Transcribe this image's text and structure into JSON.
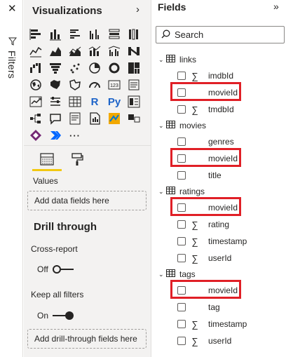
{
  "filters": {
    "label": "Filters",
    "close_icon": "close-icon",
    "funnel_icon": "funnel-icon"
  },
  "visualizations": {
    "title": "Visualizations",
    "collapse_icon": "chevron-right-icon",
    "icons": [
      "stacked-bar-chart",
      "stacked-column-chart",
      "clustered-bar-chart",
      "clustered-column-chart",
      "100-stacked-bar-chart",
      "100-stacked-column-chart",
      "line-chart",
      "area-chart",
      "stacked-area-chart",
      "line-and-stacked-column-chart",
      "line-and-clustered-column-chart",
      "ribbon-chart",
      "waterfall-chart",
      "funnel-chart",
      "scatter-chart",
      "pie-chart",
      "donut-chart",
      "treemap",
      "map",
      "filled-map",
      "shape-map",
      "gauge",
      "card",
      "multi-row-card",
      "kpi",
      "slicer",
      "table",
      "r-script-visual",
      "python-visual",
      "key-influencers",
      "decomposition-tree",
      "qna-visual",
      "smart-narrative",
      "paginated-report",
      "arcgis-map",
      "get-more-visuals",
      "power-apps",
      "power-automate",
      "more"
    ],
    "icon_text": {
      "r": "R",
      "py": "Py",
      "more": "···",
      "kpi": "123"
    },
    "values_label": "Values",
    "values_placeholder": "Add data fields here",
    "drill_through_title": "Drill through",
    "cross_report_label": "Cross-report",
    "cross_report_state": "Off",
    "keep_all_filters_label": "Keep all filters",
    "keep_all_filters_state": "On",
    "drill_placeholder": "Add drill-through fields here"
  },
  "fields": {
    "title": "Fields",
    "collapse_icon": "double-chevron-right-icon",
    "search_placeholder": "Search",
    "tables": [
      {
        "name": "links",
        "fields": [
          {
            "name": "imdbId",
            "sigma": true
          },
          {
            "name": "movieId",
            "sigma": false,
            "highlighted": true
          },
          {
            "name": "tmdbId",
            "sigma": true
          }
        ]
      },
      {
        "name": "movies",
        "fields": [
          {
            "name": "genres",
            "sigma": false
          },
          {
            "name": "movieId",
            "sigma": false,
            "highlighted": true
          },
          {
            "name": "title",
            "sigma": false
          }
        ]
      },
      {
        "name": "ratings",
        "fields": [
          {
            "name": "movieId",
            "sigma": false,
            "highlighted": true
          },
          {
            "name": "rating",
            "sigma": true
          },
          {
            "name": "timestamp",
            "sigma": true
          },
          {
            "name": "userId",
            "sigma": true
          }
        ]
      },
      {
        "name": "tags",
        "fields": [
          {
            "name": "movieId",
            "sigma": false,
            "highlighted": true
          },
          {
            "name": "tag",
            "sigma": false
          },
          {
            "name": "timestamp",
            "sigma": true
          },
          {
            "name": "userId",
            "sigma": true
          }
        ]
      }
    ],
    "sigma_symbol": "∑",
    "highlight_color": "#e01f26"
  },
  "colors": {
    "accent": "#f2c811",
    "pane_bg": "#f3f2f1",
    "text": "#252423"
  }
}
